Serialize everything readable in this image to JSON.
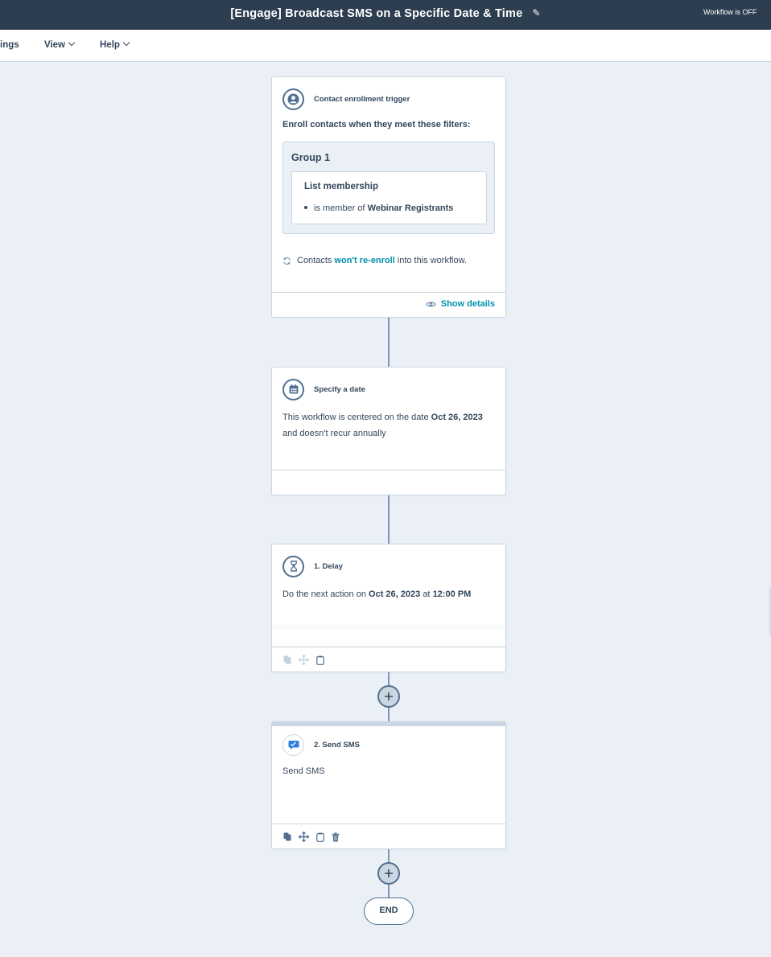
{
  "header": {
    "title": "[Engage] Broadcast SMS on a Specific Date & Time",
    "edit_icon": "pencil-icon",
    "status_text": "Workflow is OFF"
  },
  "menu": {
    "items": [
      {
        "label": "Settings",
        "visible_label": "ings",
        "has_dropdown": false
      },
      {
        "label": "View",
        "has_dropdown": true
      },
      {
        "label": "Help",
        "has_dropdown": true
      }
    ]
  },
  "workflow": {
    "trigger": {
      "icon": "contact-icon",
      "title": "Contact enrollment trigger",
      "intro": "Enroll contacts when they meet these filters:",
      "group_title": "Group 1",
      "filter_title": "List membership",
      "filter_prefix": "is member of",
      "filter_value": "Webinar Registrants",
      "reenroll_icon": "refresh-icon",
      "reenroll_prefix": "Contacts",
      "reenroll_link": "won't re-enroll",
      "reenroll_suffix": "into this workflow.",
      "show_details_icon": "eye-icon",
      "show_details_label": "Show details"
    },
    "date_step": {
      "icon": "calendar-icon",
      "title": "Specify a date",
      "text_prefix": "This workflow is centered on the date",
      "date": "Oct 26, 2023",
      "text_suffix": "and doesn't recur annually"
    },
    "delay_step": {
      "icon": "hourglass-icon",
      "title": "1. Delay",
      "text_prefix": "Do the next action on",
      "date": "Oct 26, 2023",
      "text_mid": "at",
      "time": "12:00 PM",
      "tools": [
        "copy-icon",
        "move-icon",
        "clipboard-icon"
      ]
    },
    "sms_step": {
      "icon": "sms-icon",
      "title": "2. Send SMS",
      "text": "Send SMS",
      "tools": [
        "copy-icon",
        "move-icon",
        "clipboard-icon",
        "trash-icon"
      ]
    },
    "add_action_label": "+",
    "end_label": "END"
  },
  "colors": {
    "topbar": "#2d3e50",
    "canvas": "#eaf0f6",
    "link": "#0091ae",
    "text": "#33475b",
    "connector": "#7c98b6"
  }
}
